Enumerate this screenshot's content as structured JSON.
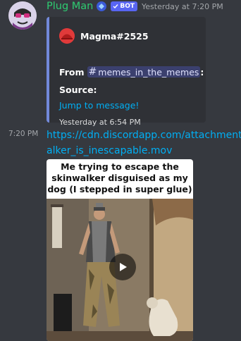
{
  "message": {
    "author": "Plug Man",
    "bot_tag": "BOT",
    "timestamp": "Yesterday at 7:20 PM"
  },
  "embed": {
    "author_name": "Magma#2525",
    "from_label": "From",
    "channel": "memes_in_the_memes",
    "from_suffix": ":",
    "source_label": "Source:",
    "link_label": "Jump to message!",
    "footer": "Yesterday at 6:54 PM"
  },
  "attachment": {
    "time": "7:20 PM",
    "url_line1": "https://cdn.discordapp.com/attachments/",
    "url_line2": "alker_is_inescapable.mov",
    "caption_line1": "Me trying to escape the",
    "caption_line2": "skinwalker disguised as my",
    "caption_line3": "dog (I stepped in super glue)"
  },
  "colors": {
    "background": "#36393f",
    "author": "#2ecc71",
    "bot_tag": "#5865f2",
    "link": "#00aff4",
    "embed_bar": "#7289da"
  },
  "icons": [
    "avatar",
    "verified-bot-check-icon",
    "play-icon"
  ]
}
